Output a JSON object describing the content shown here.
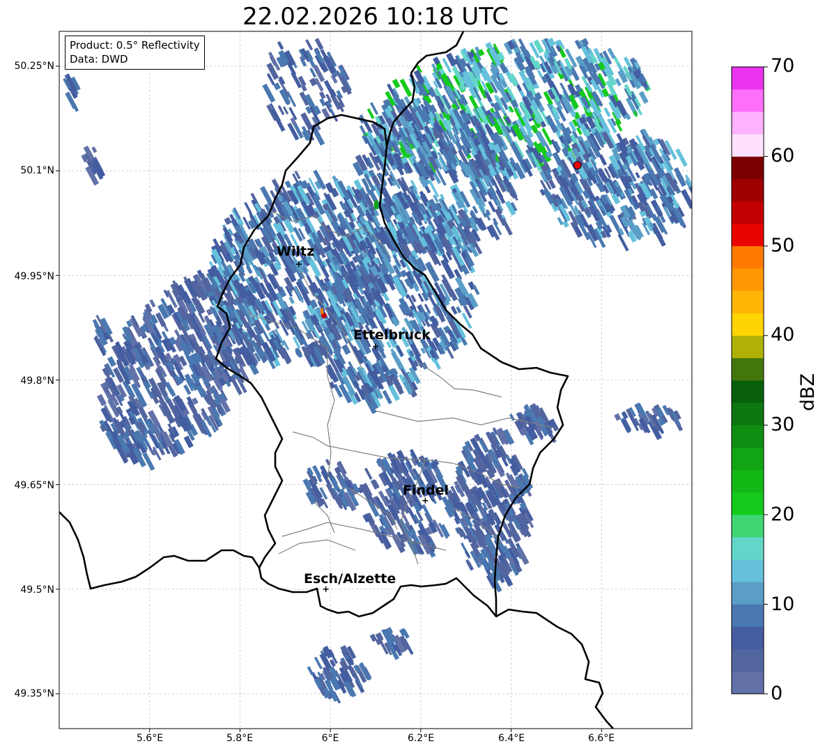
{
  "title": "22.02.2026 10:18 UTC",
  "info": {
    "line1": "Product: 0.5° Reflectivity",
    "line2": "Data: DWD"
  },
  "lat_labels": [
    "50.25°N",
    "50.1°N",
    "49.95°N",
    "49.8°N",
    "49.65°N",
    "49.5°N",
    "49.35°N"
  ],
  "lon_labels": [
    "5.6°E",
    "5.8°E",
    "6°E",
    "6.2°E",
    "6.4°E",
    "6.6°E"
  ],
  "cities": [
    {
      "name": "Wiltz",
      "lon": 5.93,
      "lat": 49.966
    },
    {
      "name": "Ettelbruck",
      "lon": 6.1,
      "lat": 49.848
    },
    {
      "name": "Findel",
      "lon": 6.21,
      "lat": 49.627
    },
    {
      "name": "Esch/Alzette",
      "lon": 5.99,
      "lat": 49.5
    }
  ],
  "radar_site": {
    "lon": 6.55,
    "lat": 50.11,
    "color": "#e8000b"
  },
  "colorbar": {
    "label": "dBZ",
    "ticks": [
      "0",
      "10",
      "20",
      "30",
      "40",
      "50",
      "60",
      "70"
    ],
    "colors": [
      "#6271a8",
      "#53659f",
      "#435da0",
      "#4a78b0",
      "#5a9ec7",
      "#66c1dc",
      "#63d6c9",
      "#3ed672",
      "#14ca1c",
      "#13b817",
      "#11a413",
      "#0f8d11",
      "#0c7710",
      "#08600d",
      "#44770b",
      "#afb107",
      "#ffd400",
      "#ffb406",
      "#ff9802",
      "#ff7b00",
      "#e80300",
      "#c30001",
      "#9f0000",
      "#7b0000",
      "#ffe1ff",
      "#ffb2ff",
      "#ff6ffb",
      "#ea33ed"
    ]
  },
  "map_extent": {
    "lon_min": 5.4,
    "lon_max": 6.8,
    "lat_min": 49.3,
    "lat_max": 50.3
  }
}
